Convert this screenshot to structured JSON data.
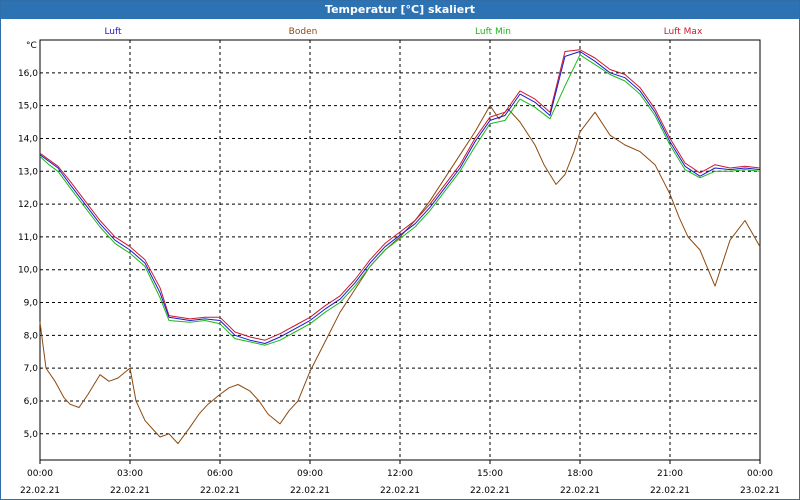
{
  "window": {
    "title": "Temperatur [°C] skaliert"
  },
  "chart_data": {
    "type": "line",
    "title": "Temperatur [°C] skaliert",
    "ylabel": "°C",
    "ylim": [
      4.2,
      17.0
    ],
    "yticks": [
      5.0,
      6.0,
      7.0,
      8.0,
      9.0,
      10.0,
      11.0,
      12.0,
      13.0,
      14.0,
      15.0,
      16.0
    ],
    "ytick_labels": [
      "5,0",
      "6,0",
      "7,0",
      "8,0",
      "9,0",
      "10,0",
      "11,0",
      "12,0",
      "13,0",
      "14,0",
      "15,0",
      "16,0"
    ],
    "xlim": [
      0,
      24
    ],
    "xticks": [
      0,
      3,
      6,
      9,
      12,
      15,
      18,
      21,
      24
    ],
    "xtick_times": [
      "00:00",
      "03:00",
      "06:00",
      "09:00",
      "12:00",
      "15:00",
      "18:00",
      "21:00",
      "00:00"
    ],
    "xtick_dates": [
      "22.02.21",
      "22.02.21",
      "22.02.21",
      "22.02.21",
      "22.02.21",
      "22.02.21",
      "22.02.21",
      "22.02.21",
      "23.02.21"
    ],
    "grid": true,
    "legend_position": "top",
    "series": [
      {
        "name": "Luft",
        "color": "#1a1ad0",
        "x": [
          0,
          0.3,
          0.6,
          1,
          1.5,
          2,
          2.5,
          3,
          3.5,
          4,
          4.3,
          5,
          5.5,
          6,
          6.5,
          7,
          7.5,
          8,
          8.5,
          9,
          9.5,
          10,
          10.5,
          11,
          11.5,
          12,
          12.5,
          13,
          13.5,
          14,
          14.5,
          15,
          15.5,
          16,
          16.5,
          17,
          17.5,
          18,
          18.5,
          19,
          19.5,
          20,
          20.5,
          21,
          21.5,
          22,
          22.5,
          23,
          23.5,
          24
        ],
        "y": [
          13.5,
          13.3,
          13.1,
          12.6,
          12.0,
          11.4,
          10.9,
          10.6,
          10.2,
          9.3,
          8.55,
          8.45,
          8.5,
          8.45,
          8.0,
          7.85,
          7.75,
          7.95,
          8.2,
          8.45,
          8.8,
          9.1,
          9.6,
          10.2,
          10.7,
          11.05,
          11.4,
          11.9,
          12.5,
          13.1,
          13.9,
          14.55,
          14.7,
          15.35,
          15.1,
          14.7,
          16.5,
          16.65,
          16.35,
          16.0,
          15.85,
          15.45,
          14.8,
          13.9,
          13.15,
          12.85,
          13.1,
          13.05,
          13.1,
          13.05
        ]
      },
      {
        "name": "Boden",
        "color": "#8b4a10",
        "x": [
          0,
          0.2,
          0.5,
          0.8,
          1,
          1.3,
          1.6,
          2,
          2.3,
          2.6,
          3,
          3.2,
          3.5,
          3.8,
          4,
          4.3,
          4.6,
          5,
          5.3,
          5.6,
          6,
          6.3,
          6.6,
          7,
          7.3,
          7.6,
          8,
          8.3,
          8.6,
          9,
          9.5,
          10,
          10.5,
          11,
          11.5,
          12,
          12.5,
          13,
          13.5,
          14,
          14.5,
          15,
          15.3,
          15.6,
          16,
          16.5,
          16.8,
          17.2,
          17.5,
          17.8,
          18,
          18.5,
          19,
          19.5,
          20,
          20.5,
          21,
          21.3,
          21.6,
          22,
          22.5,
          23,
          23.5,
          24
        ],
        "y": [
          8.4,
          7.0,
          6.6,
          6.1,
          5.9,
          5.8,
          6.2,
          6.8,
          6.6,
          6.7,
          7.0,
          6.0,
          5.4,
          5.1,
          4.9,
          5.0,
          4.7,
          5.2,
          5.6,
          5.9,
          6.2,
          6.4,
          6.5,
          6.3,
          6.0,
          5.6,
          5.3,
          5.7,
          6.0,
          6.9,
          7.8,
          8.7,
          9.4,
          10.1,
          10.6,
          11.0,
          11.5,
          12.1,
          12.8,
          13.5,
          14.2,
          15.0,
          14.6,
          14.9,
          14.5,
          13.8,
          13.2,
          12.6,
          12.9,
          13.6,
          14.2,
          14.8,
          14.1,
          13.8,
          13.6,
          13.2,
          12.3,
          11.6,
          11.0,
          10.6,
          9.5,
          10.9,
          11.5,
          10.7
        ]
      },
      {
        "name": "Luft Min",
        "color": "#1ab81a",
        "x": [
          0,
          0.3,
          0.6,
          1,
          1.5,
          2,
          2.5,
          3,
          3.5,
          4,
          4.3,
          5,
          5.5,
          6,
          6.5,
          7,
          7.5,
          8,
          8.5,
          9,
          9.5,
          10,
          10.5,
          11,
          11.5,
          12,
          12.5,
          13,
          13.5,
          14,
          14.5,
          15,
          15.5,
          16,
          16.5,
          17,
          17.5,
          18,
          18.5,
          19,
          19.5,
          20,
          20.5,
          21,
          21.5,
          22,
          22.5,
          23,
          23.5,
          24
        ],
        "y": [
          13.45,
          13.2,
          13.0,
          12.5,
          11.9,
          11.3,
          10.8,
          10.5,
          10.1,
          9.15,
          8.45,
          8.4,
          8.45,
          8.35,
          7.9,
          7.8,
          7.7,
          7.85,
          8.1,
          8.35,
          8.7,
          9.0,
          9.5,
          10.1,
          10.6,
          10.95,
          11.3,
          11.8,
          12.4,
          13.0,
          13.75,
          14.45,
          14.55,
          15.2,
          14.95,
          14.6,
          15.6,
          16.55,
          16.25,
          15.95,
          15.75,
          15.35,
          14.7,
          13.8,
          13.05,
          12.8,
          13.0,
          13.0,
          13.05,
          13.0
        ]
      },
      {
        "name": "Luft Max",
        "color": "#c81a30",
        "x": [
          0,
          0.3,
          0.6,
          1,
          1.5,
          2,
          2.5,
          3,
          3.5,
          4,
          4.3,
          5,
          5.5,
          6,
          6.5,
          7,
          7.5,
          8,
          8.5,
          9,
          9.5,
          10,
          10.5,
          11,
          11.5,
          12,
          12.5,
          13,
          13.5,
          14,
          14.5,
          15,
          15.5,
          16,
          16.5,
          17,
          17.5,
          18,
          18.5,
          19,
          19.5,
          20,
          20.5,
          21,
          21.5,
          22,
          22.5,
          23,
          23.5,
          24
        ],
        "y": [
          13.55,
          13.35,
          13.15,
          12.7,
          12.1,
          11.5,
          11.0,
          10.7,
          10.3,
          9.45,
          8.6,
          8.5,
          8.55,
          8.55,
          8.1,
          7.95,
          7.85,
          8.05,
          8.3,
          8.55,
          8.9,
          9.2,
          9.7,
          10.3,
          10.8,
          11.15,
          11.5,
          12.0,
          12.6,
          13.2,
          14.0,
          14.65,
          14.8,
          15.45,
          15.2,
          14.8,
          16.65,
          16.7,
          16.45,
          16.1,
          15.95,
          15.55,
          14.9,
          14.0,
          13.25,
          12.95,
          13.2,
          13.1,
          13.15,
          13.1
        ]
      }
    ]
  }
}
